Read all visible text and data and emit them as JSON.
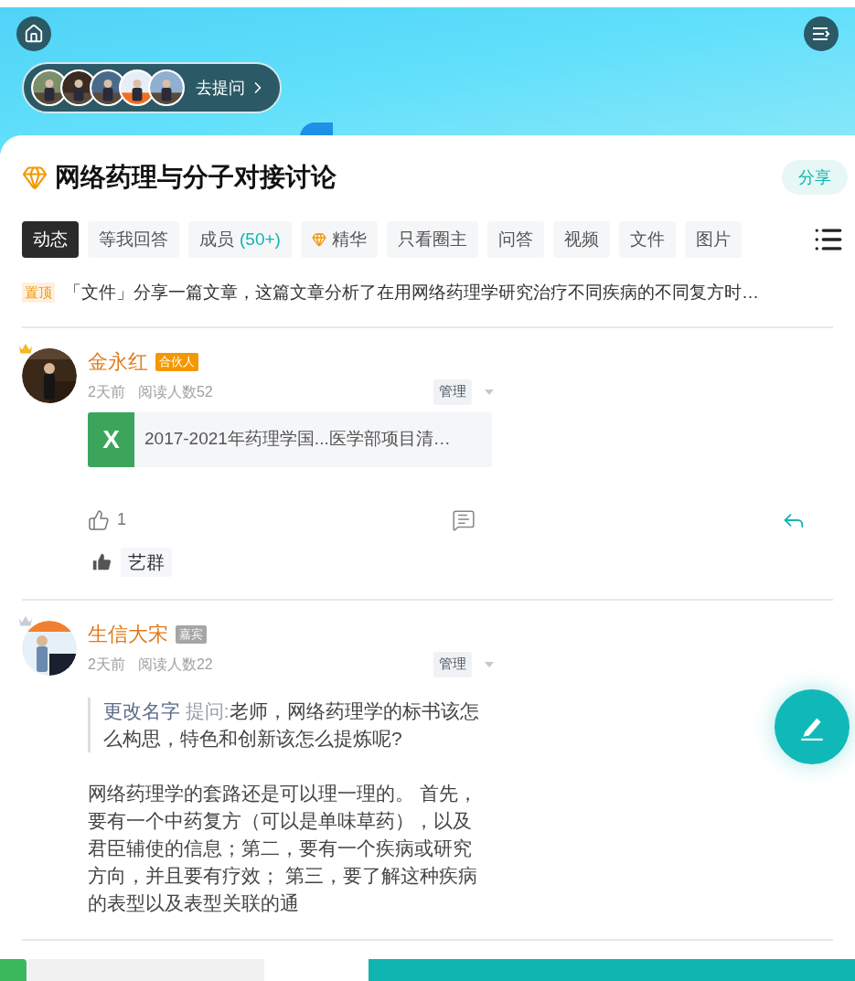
{
  "header": {
    "ask_button": "去提问"
  },
  "group": {
    "title": "网络药理与分子对接讨论",
    "share": "分享"
  },
  "tabs": [
    {
      "label": "动态",
      "selected": true
    },
    {
      "label": "等我回答",
      "selected": false
    },
    {
      "label": "成员",
      "count": "(50+)",
      "selected": false
    },
    {
      "label": "精华",
      "kind": "featured",
      "selected": false
    },
    {
      "label": "只看圈主",
      "selected": false
    },
    {
      "label": "问答",
      "selected": false
    },
    {
      "label": "视频",
      "selected": false
    },
    {
      "label": "文件",
      "selected": false
    },
    {
      "label": "图片",
      "selected": false
    }
  ],
  "pinned": {
    "badge": "置顶",
    "text": "「文件」分享一篇文章，这篇文章分析了在用网络药理学研究治疗不同疾病的不同复方时…"
  },
  "posts": [
    {
      "author": "金永红",
      "badge": {
        "label": "合伙人",
        "color": "#f39800"
      },
      "time": "2天前",
      "reads": "阅读人数52",
      "manage": "管理",
      "attachment": {
        "kind": "excel",
        "letter": "X",
        "name": "2017-2021年药理学国...医学部项目清…"
      },
      "likes": "1",
      "liked_by": [
        "艺群"
      ]
    },
    {
      "author": "生信大宋",
      "badge": {
        "label": "嘉宾",
        "color": "#a6a6a6"
      },
      "time": "2天前",
      "reads": "阅读人数22",
      "manage": "管理",
      "quote": {
        "author": "更改名字",
        "label": "提问:",
        "text": "老师，网络药理学的标书该怎么构思，特色和创新该怎么提炼呢?"
      },
      "body": "网络药理学的套路还是可以理一理的。 首先，要有一个中药复方（可以是单味草药），以及君臣辅使的信息；第二，要有一个疾病或研究方向，并且要有疗效； 第三，要了解这种疾病的表型以及表型关联的通"
    }
  ]
}
